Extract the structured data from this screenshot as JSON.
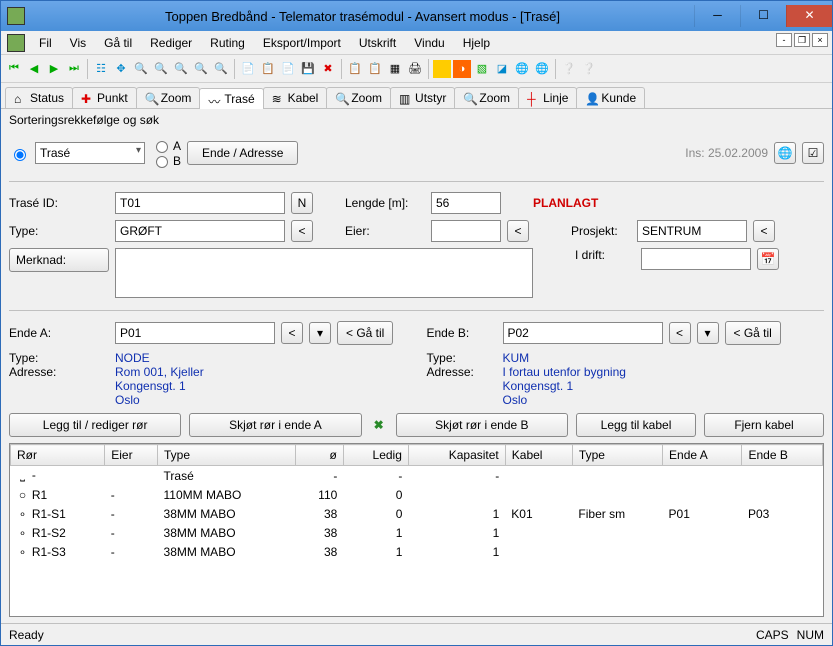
{
  "title": "Toppen Bredbånd - Telemator trasémodul - Avansert modus - [Trasé]",
  "menus": [
    "Fil",
    "Vis",
    "Gå til",
    "Rediger",
    "Ruting",
    "Eksport/Import",
    "Utskrift",
    "Vindu",
    "Hjelp"
  ],
  "tabs": [
    {
      "label": "Status",
      "icon": "home-icon"
    },
    {
      "label": "Punkt",
      "icon": "plus-icon"
    },
    {
      "label": "Zoom",
      "icon": "zoom-icon"
    },
    {
      "label": "Trasé",
      "icon": "trace-icon",
      "active": true
    },
    {
      "label": "Kabel",
      "icon": "cable-icon"
    },
    {
      "label": "Zoom",
      "icon": "zoom-icon"
    },
    {
      "label": "Utstyr",
      "icon": "equipment-icon"
    },
    {
      "label": "Zoom",
      "icon": "zoom-icon"
    },
    {
      "label": "Linje",
      "icon": "line-icon"
    },
    {
      "label": "Kunde",
      "icon": "customer-icon"
    }
  ],
  "sort": {
    "title": "Sorteringsrekkefølge og søk",
    "combo": "Trasé",
    "optA": "A",
    "optB": "B",
    "btn": "Ende / Adresse",
    "ins": "Ins: 25.02.2009"
  },
  "form": {
    "trase_id_label": "Trasé ID:",
    "trase_id": "T01",
    "n": "N",
    "lengde_label": "Lengde [m]:",
    "lengde": "56",
    "status": "PLANLAGT",
    "type_label": "Type:",
    "type": "GRØFT",
    "lt": "<",
    "eier_label": "Eier:",
    "eier": "",
    "prosjekt_label": "Prosjekt:",
    "prosjekt": "SENTRUM",
    "merknad_label": "Merknad:",
    "merknad": "",
    "idrift_label": "I drift:",
    "idrift": ""
  },
  "endA": {
    "label": "Ende A:",
    "value": "P01",
    "go": "< Gå til",
    "type_label": "Type:",
    "type": "NODE",
    "addr_label": "Adresse:",
    "addr1": "Rom 001, Kjeller",
    "addr2": "Kongensgt. 1",
    "addr3": "Oslo"
  },
  "endB": {
    "label": "Ende B:",
    "value": "P02",
    "go": "< Gå til",
    "type_label": "Type:",
    "type": "KUM",
    "addr_label": "Adresse:",
    "addr1": "I fortau utenfor bygning",
    "addr2": "Kongensgt. 1",
    "addr3": "Oslo"
  },
  "actions": {
    "edit_pipes": "Legg til / rediger rør",
    "splice_a": "Skjøt rør i ende A",
    "splice_b": "Skjøt rør i ende B",
    "add_cable": "Legg til kabel",
    "remove_cable": "Fjern kabel"
  },
  "grid": {
    "headers": [
      "Rør",
      "Eier",
      "Type",
      "ø",
      "Ledig",
      "Kapasitet",
      "Kabel",
      "Type",
      "Ende A",
      "Ende B"
    ],
    "rows": [
      {
        "icon": "⎵",
        "ror": "-",
        "eier": "",
        "type": "Trasé",
        "o": "-",
        "ledig": "-",
        "kap": "-",
        "kabel": "",
        "ktype": "",
        "ea": "",
        "eb": ""
      },
      {
        "icon": "○",
        "ror": "R1",
        "eier": "-",
        "type": "110MM MABO",
        "o": "110",
        "ledig": "0",
        "kap": "",
        "kabel": "",
        "ktype": "",
        "ea": "",
        "eb": ""
      },
      {
        "icon": "∘",
        "ror": "R1-S1",
        "eier": "-",
        "type": "38MM MABO",
        "o": "38",
        "ledig": "0",
        "kap": "1",
        "kabel": "K01",
        "ktype": "Fiber sm",
        "ea": "P01",
        "eb": "P03"
      },
      {
        "icon": "∘",
        "ror": "R1-S2",
        "eier": "-",
        "type": "38MM MABO",
        "o": "38",
        "ledig": "1",
        "kap": "1",
        "kabel": "",
        "ktype": "",
        "ea": "",
        "eb": ""
      },
      {
        "icon": "∘",
        "ror": "R1-S3",
        "eier": "-",
        "type": "38MM MABO",
        "o": "38",
        "ledig": "1",
        "kap": "1",
        "kabel": "",
        "ktype": "",
        "ea": "",
        "eb": ""
      }
    ]
  },
  "statusbar": {
    "ready": "Ready",
    "caps": "CAPS",
    "num": "NUM"
  }
}
